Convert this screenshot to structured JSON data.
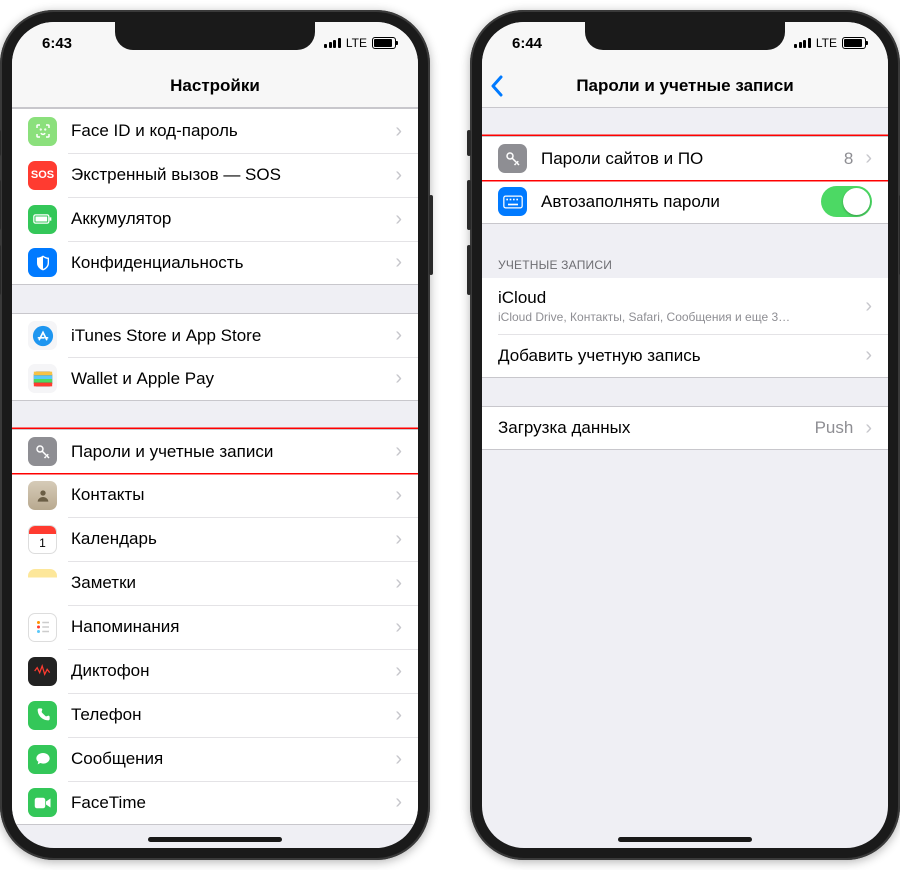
{
  "status": {
    "lte": "LTE"
  },
  "left": {
    "time": "6:43",
    "nav_title": "Настройки",
    "groups": [
      {
        "rows": [
          {
            "id": "faceid",
            "label": "Face ID и код-пароль",
            "icon": "faceid-icon"
          },
          {
            "id": "sos",
            "label": "Экстренный вызов — SOS",
            "icon": "sos-icon"
          },
          {
            "id": "battery",
            "label": "Аккумулятор",
            "icon": "battery-icon"
          },
          {
            "id": "privacy",
            "label": "Конфиденциальность",
            "icon": "privacy-icon"
          }
        ]
      },
      {
        "rows": [
          {
            "id": "appstore",
            "label": "iTunes Store и App Store",
            "icon": "appstore-icon"
          },
          {
            "id": "wallet",
            "label": "Wallet и Apple Pay",
            "icon": "wallet-icon"
          }
        ]
      },
      {
        "rows": [
          {
            "id": "passwords",
            "label": "Пароли и учетные записи",
            "icon": "keys-icon",
            "highlight": true
          },
          {
            "id": "contacts",
            "label": "Контакты",
            "icon": "contacts-icon"
          },
          {
            "id": "calendar",
            "label": "Календарь",
            "icon": "calendar-icon"
          },
          {
            "id": "notes",
            "label": "Заметки",
            "icon": "notes-icon"
          },
          {
            "id": "reminders",
            "label": "Напоминания",
            "icon": "reminders-icon"
          },
          {
            "id": "voice",
            "label": "Диктофон",
            "icon": "voice-icon"
          },
          {
            "id": "phone",
            "label": "Телефон",
            "icon": "phone-icon"
          },
          {
            "id": "messages",
            "label": "Сообщения",
            "icon": "messages-icon"
          },
          {
            "id": "facetime",
            "label": "FaceTime",
            "icon": "facetime-icon"
          }
        ]
      }
    ]
  },
  "right": {
    "time": "6:44",
    "nav_title": "Пароли и учетные записи",
    "group1": {
      "rows": [
        {
          "id": "site-passwords",
          "label": "Пароли сайтов и ПО",
          "detail": "8",
          "icon": "keys-icon",
          "highlight": true
        },
        {
          "id": "autofill",
          "label": "Автозаполнять пароли",
          "icon": "keyboard-icon",
          "toggle": true
        }
      ]
    },
    "group2": {
      "header": "УЧЕТНЫЕ ЗАПИСИ",
      "rows": [
        {
          "id": "icloud",
          "label": "iCloud",
          "sublabel": "iCloud Drive, Контакты, Safari, Сообщения и еще 3…"
        },
        {
          "id": "addacc",
          "label": "Добавить учетную запись"
        }
      ]
    },
    "group3": {
      "rows": [
        {
          "id": "fetch",
          "label": "Загрузка данных",
          "detail": "Push"
        }
      ]
    }
  }
}
